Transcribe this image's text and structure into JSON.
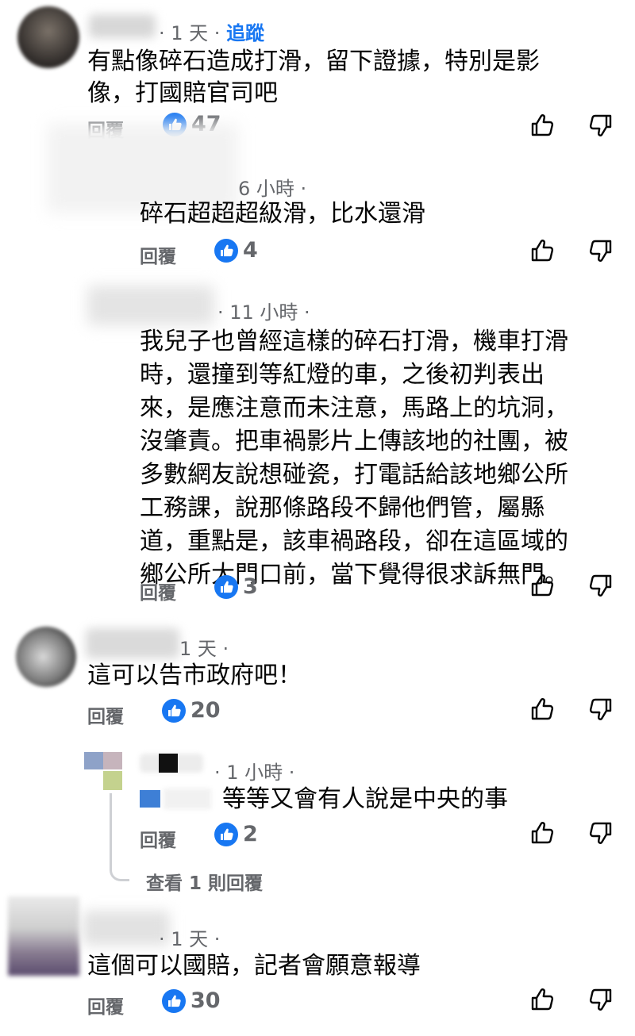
{
  "comments": [
    {
      "time": "· 1 天 ·",
      "follow": "追蹤",
      "lines": [
        "有點像碎石造成打滑，留下證據，特別是影",
        "像，打國賠官司吧"
      ],
      "reply": "回覆",
      "likes": "47"
    },
    {
      "time": "6 小時 ·",
      "lines": [
        "碎石超超超級滑，比水還滑"
      ],
      "reply": "回覆",
      "likes": "4"
    },
    {
      "time": "· 11 小時 ·",
      "lines": [
        "我兒子也曾經這樣的碎石打滑，機車打滑",
        "時，還撞到等紅燈的車，之後初判表出",
        "來，是應注意而未注意，馬路上的坑洞，",
        "沒肇責。把車禍影片上傳該地的社團，被",
        "多數網友說想碰瓷，打電話給該地鄉公所",
        "工務課，說那條路段不歸他們管，屬縣",
        "道，重點是，該車禍路段，卻在這區域的",
        "鄉公所大門口前，當下覺得很求訴無門。"
      ],
      "reply": "回覆",
      "likes": "3"
    },
    {
      "time": "1 天 ·",
      "lines": [
        "這可以告市政府吧！"
      ],
      "reply": "回覆",
      "likes": "20"
    },
    {
      "time": "· 1 小時 ·",
      "lines": [
        "等等又會有人說是中央的事"
      ],
      "reply": "回覆",
      "likes": "2",
      "view_replies": "查看 1 則回覆"
    },
    {
      "time": "· 1 天 ·",
      "lines": [
        "這個可以國賠，記者會願意報導"
      ],
      "reply": "回覆",
      "likes": "30"
    }
  ],
  "colors": {
    "accent": "#1877f2",
    "secondary_text": "#65676b"
  },
  "icons": {
    "like_action": "thumbs-up-icon",
    "dislike_action": "thumbs-down-icon",
    "like_badge": "like-badge-icon"
  }
}
